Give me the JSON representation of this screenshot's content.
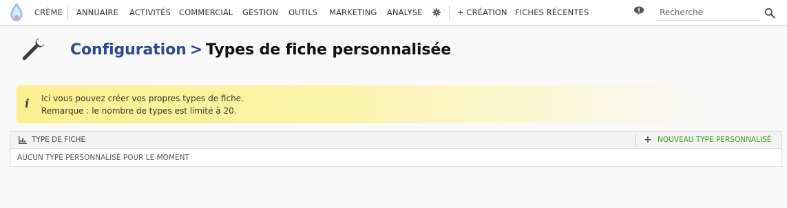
{
  "menu": {
    "items": [
      "Crème",
      "Annuaire",
      "Activités",
      "Commercial",
      "Gestion",
      "Outils",
      "Marketing",
      "Analyse"
    ],
    "creation": "+ Création",
    "recent": "Fiches récentes",
    "search_placeholder": "Recherche"
  },
  "header": {
    "breadcrumb": "Configuration",
    "separator": ">",
    "title": "Types de fiche personnalisée"
  },
  "info": {
    "line1": "Ici vous pouvez créer vos propres types de fiche.",
    "line2": "Remarque : le nombre de types est limité à 20."
  },
  "table": {
    "column": "Type de fiche",
    "add_label": "Nouveau type personnalisé",
    "empty": "Aucun type personnalisé pour le moment"
  },
  "colors": {
    "brand_blue": "#2f4a91",
    "add_green": "#3d9b1c",
    "info_yellow": "#fbf090"
  },
  "icons": [
    "app-logo-icon",
    "gear-icon",
    "chat-bubble-icon",
    "search-icon",
    "wrench-icon",
    "info-icon",
    "table-icon",
    "plus-icon"
  ]
}
